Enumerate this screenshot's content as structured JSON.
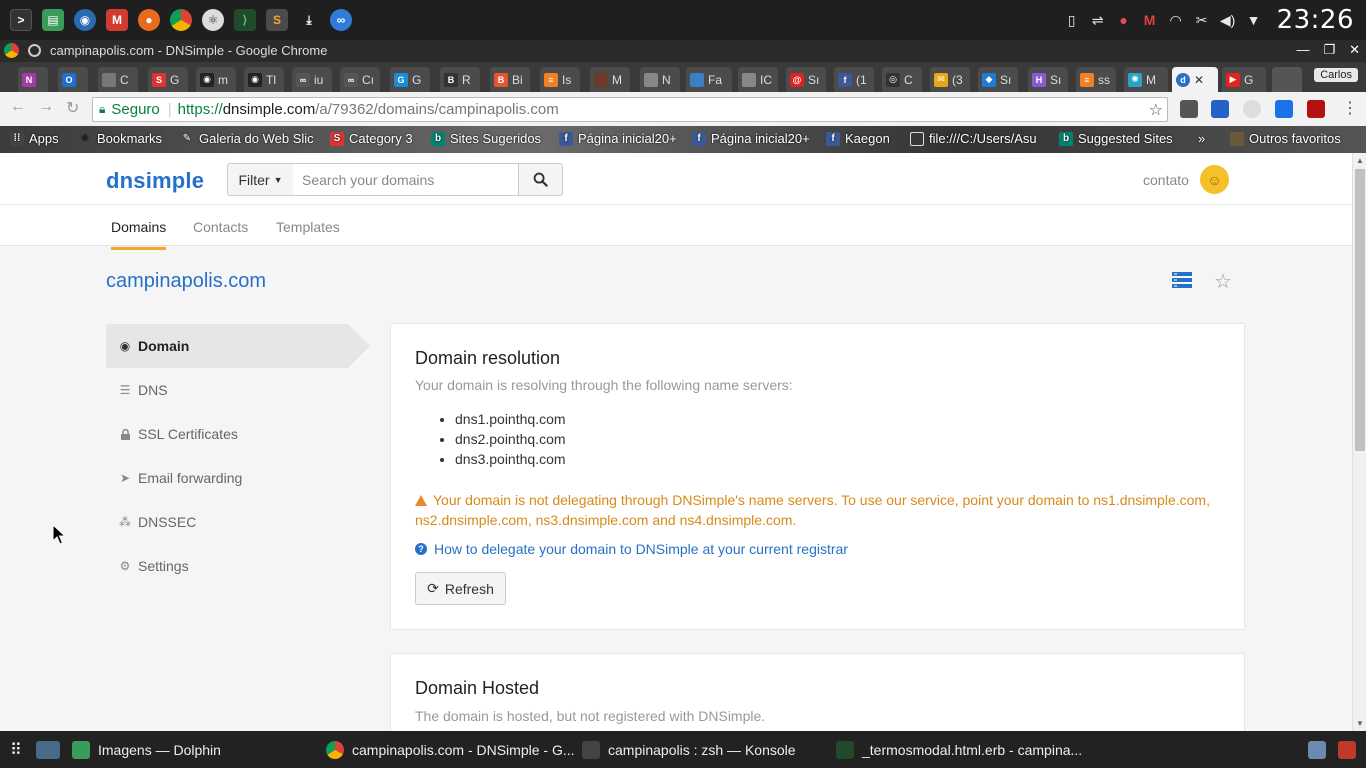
{
  "system": {
    "clock": "23:26",
    "tray_icons": [
      "phone-icon",
      "usb-icon",
      "ghost-icon",
      "gmail-icon",
      "wifi-icon",
      "scissors-icon",
      "volume-icon",
      "menu-arrow-icon"
    ]
  },
  "window": {
    "title": "campinapolis.com - DNSimple - Google Chrome"
  },
  "tabs": {
    "user": "Carlos"
  },
  "address_bar": {
    "secure_label": "Seguro",
    "url_scheme": "https://",
    "url_host": "dnsimple.com",
    "url_path": "/a/79362/domains/campinapolis.com"
  },
  "bookmarks": {
    "items": [
      {
        "label": "Apps"
      },
      {
        "label": "Bookmarks"
      },
      {
        "label": "Galeria do Web Slic"
      },
      {
        "label": "Category 3"
      },
      {
        "label": "Sites Sugeridos"
      },
      {
        "label": "Página inicial20+"
      },
      {
        "label": "Página inicial20+"
      },
      {
        "label": "Kaegon"
      },
      {
        "label": "file:///C:/Users/Asu"
      },
      {
        "label": "Suggested Sites"
      }
    ],
    "more": "»",
    "other": "Outros favoritos"
  },
  "header": {
    "logo": "dnsimple",
    "filter_label": "Filter",
    "search_placeholder": "Search your domains",
    "user": "contato"
  },
  "subnav": {
    "tabs": [
      {
        "label": "Domains",
        "active": true
      },
      {
        "label": "Contacts",
        "active": false
      },
      {
        "label": "Templates",
        "active": false
      }
    ]
  },
  "domain": {
    "name": "campinapolis.com"
  },
  "sidebar": {
    "items": [
      {
        "label": "Domain",
        "icon": "globe-icon",
        "active": true
      },
      {
        "label": "DNS",
        "icon": "list-icon",
        "active": false
      },
      {
        "label": "SSL Certificates",
        "icon": "lock-icon",
        "active": false
      },
      {
        "label": "Email forwarding",
        "icon": "paper-plane-icon",
        "active": false
      },
      {
        "label": "DNSSEC",
        "icon": "cubes-icon",
        "active": false
      },
      {
        "label": "Settings",
        "icon": "gear-icon",
        "active": false
      }
    ]
  },
  "resolution": {
    "title": "Domain resolution",
    "subtitle": "Your domain is resolving through the following name servers:",
    "name_servers": [
      "dns1.pointhq.com",
      "dns2.pointhq.com",
      "dns3.pointhq.com"
    ],
    "warning": "Your domain is not delegating through DNSimple's name servers. To use our service, point your domain to ns1.dnsimple.com, ns2.dnsimple.com, ns3.dnsimple.com and ns4.dnsimple.com.",
    "help_link": "How to delegate your domain to DNSimple at your current registrar",
    "refresh_label": "Refresh"
  },
  "hosted": {
    "title": "Domain Hosted",
    "subtitle": "The domain is hosted, but not registered with DNSimple."
  },
  "taskbar": {
    "items": [
      {
        "label": "Imagens — Dolphin"
      },
      {
        "label": "campinapolis.com - DNSimple - G..."
      },
      {
        "label": "campinapolis : zsh — Konsole"
      },
      {
        "label": "_termosmodal.html.erb - campina..."
      }
    ]
  },
  "colors": {
    "brand": "#2670c9",
    "accent_tab": "#f5a623",
    "warning": "#d88a1a"
  }
}
